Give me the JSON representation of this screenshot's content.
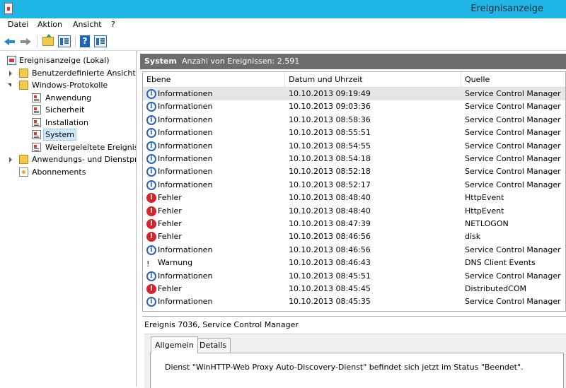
{
  "window": {
    "title": "Ereignisanzeige"
  },
  "menu": [
    "Datei",
    "Aktion",
    "Ansicht",
    "?"
  ],
  "toolbar": {
    "icons": [
      "back-arrow-icon",
      "forward-arrow-icon",
      "up-folder-icon",
      "show-hide-tree-icon",
      "help-icon",
      "show-hide-action-pane-icon"
    ],
    "help_glyph": "?"
  },
  "tree": {
    "root": "Ereignisanzeige (Lokal)",
    "custom_views": "Benutzerdefinierte Ansichten",
    "windows_logs": "Windows-Protokolle",
    "logs": [
      "Anwendung",
      "Sicherheit",
      "Installation",
      "System",
      "Weitergeleitete Ereignisse"
    ],
    "app_service_logs": "Anwendungs- und Dienstprotokolle",
    "subscriptions": "Abonnements",
    "selected": "System"
  },
  "header": {
    "name": "System",
    "count_text": "Anzahl von Ereignissen: 2.591"
  },
  "columns": {
    "level": "Ebene",
    "datetime": "Datum und Uhrzeit",
    "source": "Quelle"
  },
  "events": [
    {
      "level": "Informationen",
      "icon": "info",
      "datetime": "10.10.2013 09:19:49",
      "source": "Service Control Manager"
    },
    {
      "level": "Informationen",
      "icon": "info",
      "datetime": "10.10.2013 09:03:36",
      "source": "Service Control Manager"
    },
    {
      "level": "Informationen",
      "icon": "info",
      "datetime": "10.10.2013 08:58:36",
      "source": "Service Control Manager"
    },
    {
      "level": "Informationen",
      "icon": "info",
      "datetime": "10.10.2013 08:55:51",
      "source": "Service Control Manager"
    },
    {
      "level": "Informationen",
      "icon": "info",
      "datetime": "10.10.2013 08:54:55",
      "source": "Service Control Manager"
    },
    {
      "level": "Informationen",
      "icon": "info",
      "datetime": "10.10.2013 08:54:18",
      "source": "Service Control Manager"
    },
    {
      "level": "Informationen",
      "icon": "info",
      "datetime": "10.10.2013 08:52:18",
      "source": "Service Control Manager"
    },
    {
      "level": "Informationen",
      "icon": "info",
      "datetime": "10.10.2013 08:52:17",
      "source": "Service Control Manager"
    },
    {
      "level": "Fehler",
      "icon": "error",
      "datetime": "10.10.2013 08:48:40",
      "source": "HttpEvent"
    },
    {
      "level": "Fehler",
      "icon": "error",
      "datetime": "10.10.2013 08:48:40",
      "source": "HttpEvent"
    },
    {
      "level": "Fehler",
      "icon": "error",
      "datetime": "10.10.2013 08:47:39",
      "source": "NETLOGON"
    },
    {
      "level": "Fehler",
      "icon": "error",
      "datetime": "10.10.2013 08:46:56",
      "source": "disk"
    },
    {
      "level": "Informationen",
      "icon": "info",
      "datetime": "10.10.2013 08:46:56",
      "source": "Service Control Manager"
    },
    {
      "level": "Warnung",
      "icon": "warning",
      "datetime": "10.10.2013 08:46:43",
      "source": "DNS Client Events"
    },
    {
      "level": "Informationen",
      "icon": "info",
      "datetime": "10.10.2013 08:45:51",
      "source": "Service Control Manager"
    },
    {
      "level": "Fehler",
      "icon": "error",
      "datetime": "10.10.2013 08:45:45",
      "source": "DistributedCOM"
    },
    {
      "level": "Informationen",
      "icon": "info",
      "datetime": "10.10.2013 08:45:35",
      "source": "Service Control Manager"
    }
  ],
  "details": {
    "title": "Ereignis 7036, Service Control Manager",
    "tabs": [
      "Allgemein",
      "Details"
    ],
    "active_tab": "Allgemein",
    "description": "Dienst \"WinHTTP-Web Proxy Auto-Discovery-Dienst\" befindet sich jetzt im Status \"Beendet\"."
  },
  "colors": {
    "titlebar": "#1fb6e6",
    "header_bar": "#6d6d6d",
    "selection": "#cde8fa"
  }
}
